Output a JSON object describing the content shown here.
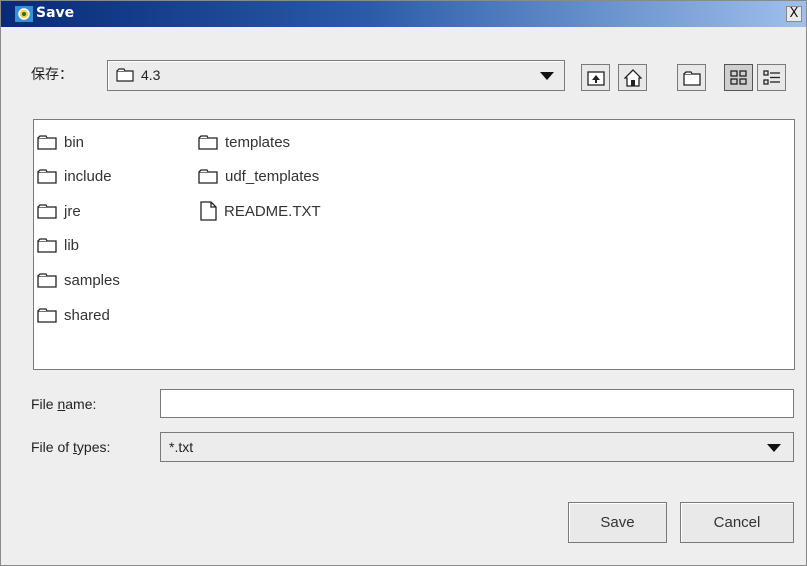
{
  "window": {
    "title": "Save",
    "close_glyph": "X"
  },
  "save_in": {
    "label": "保存：",
    "value": "4.3"
  },
  "toolbar": {
    "buttons": [
      {
        "name": "up-one-level-icon"
      },
      {
        "name": "home-icon"
      },
      {
        "name": "new-folder-icon"
      },
      {
        "name": "list-view-icon"
      },
      {
        "name": "details-view-icon"
      }
    ]
  },
  "files": {
    "col1": [
      {
        "label": "bin",
        "icon": "folder-icon"
      },
      {
        "label": "include",
        "icon": "folder-icon"
      },
      {
        "label": "jre",
        "icon": "folder-icon"
      },
      {
        "label": "lib",
        "icon": "folder-icon"
      },
      {
        "label": "samples",
        "icon": "folder-icon"
      },
      {
        "label": "shared",
        "icon": "folder-icon"
      }
    ],
    "col2": [
      {
        "label": "templates",
        "icon": "folder-icon"
      },
      {
        "label": "udf_templates",
        "icon": "folder-icon"
      },
      {
        "label": "README.TXT",
        "icon": "file-icon"
      }
    ]
  },
  "file_name": {
    "label_pre": "File ",
    "label_mnemonic": "n",
    "label_post": "ame:",
    "value": ""
  },
  "file_types": {
    "label_pre": "File of ",
    "label_mnemonic": "t",
    "label_post": "ypes:",
    "value": "*.txt"
  },
  "buttons": {
    "save": "Save",
    "cancel": "Cancel"
  }
}
